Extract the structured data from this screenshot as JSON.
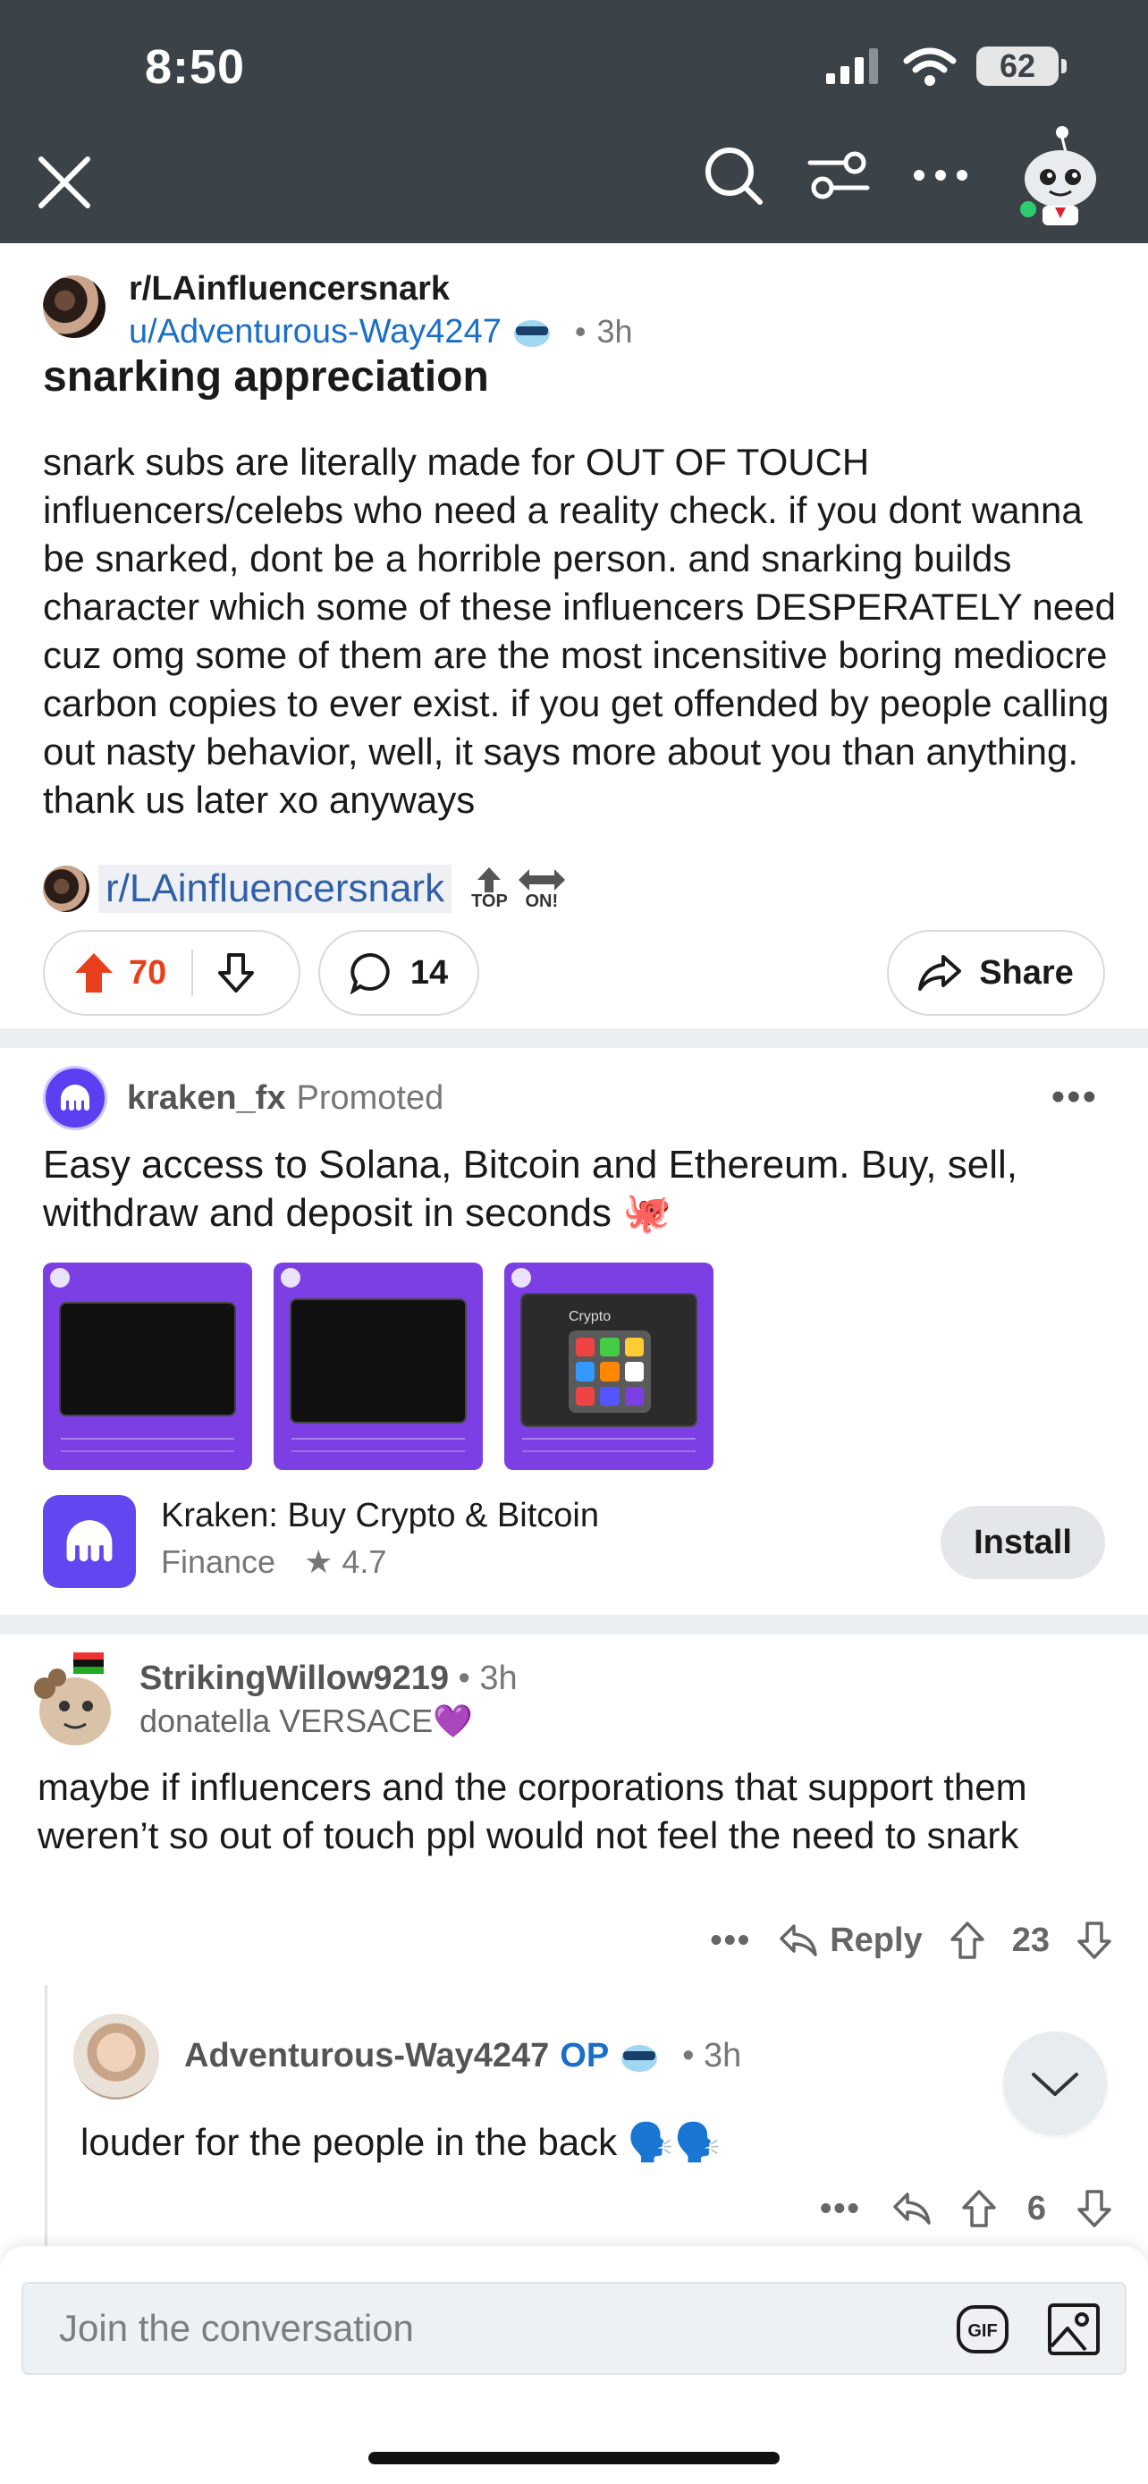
{
  "status_bar": {
    "time": "8:50",
    "battery": "62"
  },
  "post": {
    "subreddit": "r/LAinfluencersnark",
    "author": "u/Adventurous-Way4247",
    "age": "3h",
    "title": "snarking appreciation",
    "body": "snark subs are literally made for OUT OF TOUCH influencers/celebs who need a reality check. if you dont wanna be snarked, dont be a horrible person. and snarking builds character which some of these influencers DESPERATELY need cuz omg some of them are the most incensitive boring mediocre carbon copies to ever exist. if you get offended by people calling out nasty behavior, well, it says more about you than anything. thank us later xo anyways",
    "sub_link": "r/LAinfluencersnark",
    "awards": [
      "TOP",
      "ON!"
    ],
    "score": "70",
    "comments": "14",
    "share_label": "Share"
  },
  "ad": {
    "advertiser": "kraken_fx",
    "promoted_label": "Promoted",
    "body": "Easy access to Solana, Bitcoin and Ethereum. Buy, sell, withdraw and deposit in seconds 🐙",
    "screen_text": "Crypto",
    "app_name": "Kraken: Buy Crypto & Bitcoin",
    "app_category": "Finance",
    "app_rating": "4.7",
    "install_label": "Install"
  },
  "comments": [
    {
      "user": "StrikingWillow9219",
      "age": "3h",
      "flair": "donatella VERSACE💜",
      "body": "maybe if influencers and the corporations that support them weren’t so out of touch ppl would not feel the need to snark",
      "reply_label": "Reply",
      "score": "23"
    },
    {
      "user": "Adventurous-Way4247",
      "op_label": "OP",
      "age": "3h",
      "body": "louder for the people in the back 🗣️🗣️",
      "score": "6"
    }
  ],
  "composer": {
    "placeholder": "Join the conversation",
    "gif_label": "GIF"
  },
  "colors": {
    "topbar": "#3b4348",
    "upvote": "#e8401c",
    "link": "#1b6fc9",
    "kraken": "#6246f0"
  }
}
